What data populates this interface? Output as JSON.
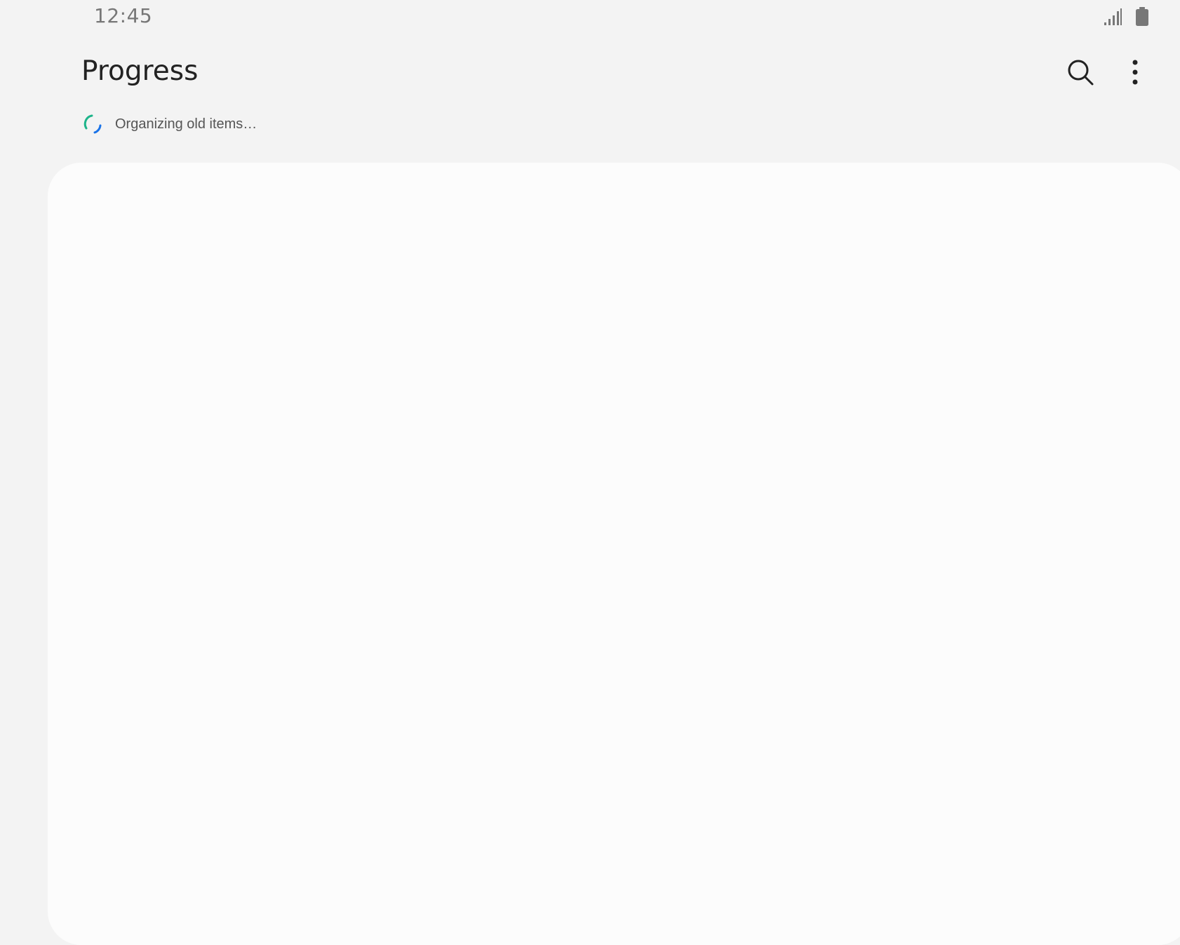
{
  "status_bar": {
    "time": "12:45",
    "signal_icon": "signal-icon",
    "battery_icon": "battery-icon"
  },
  "app_bar": {
    "title": "Progress",
    "search_icon": "search-icon",
    "more_icon": "more-vertical-icon"
  },
  "progress": {
    "message": "Organizing old items…",
    "spinner_colors": [
      "#1db48a",
      "#1a73e8"
    ]
  },
  "colors": {
    "background": "#f3f3f3",
    "card": "#fcfcfc",
    "title": "#222222",
    "status_text": "#777777"
  }
}
